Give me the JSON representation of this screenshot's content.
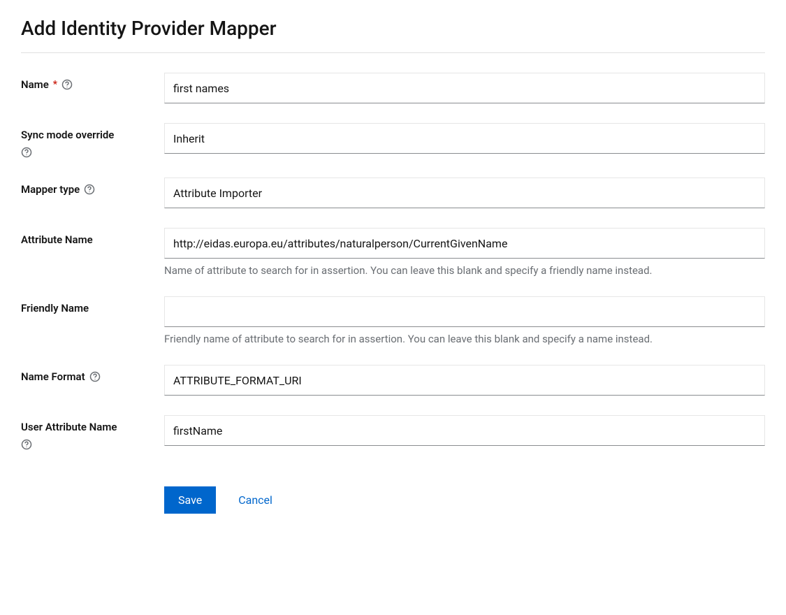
{
  "title": "Add Identity Provider Mapper",
  "fields": {
    "name": {
      "label": "Name",
      "value": "first names"
    },
    "sync": {
      "label": "Sync mode override",
      "value": "Inherit"
    },
    "mapper_type": {
      "label": "Mapper type",
      "value": "Attribute Importer"
    },
    "attr_name": {
      "label": "Attribute Name",
      "value": "http://eidas.europa.eu/attributes/naturalperson/CurrentGivenName",
      "helper": "Name of attribute to search for in assertion. You can leave this blank and specify a friendly name instead."
    },
    "friendly": {
      "label": "Friendly Name",
      "value": "",
      "helper": "Friendly name of attribute to search for in assertion. You can leave this blank and specify a name instead."
    },
    "name_format": {
      "label": "Name Format",
      "value": "ATTRIBUTE_FORMAT_URI"
    },
    "user_attr": {
      "label": "User Attribute Name",
      "value": "firstName"
    }
  },
  "buttons": {
    "save": "Save",
    "cancel": "Cancel"
  }
}
